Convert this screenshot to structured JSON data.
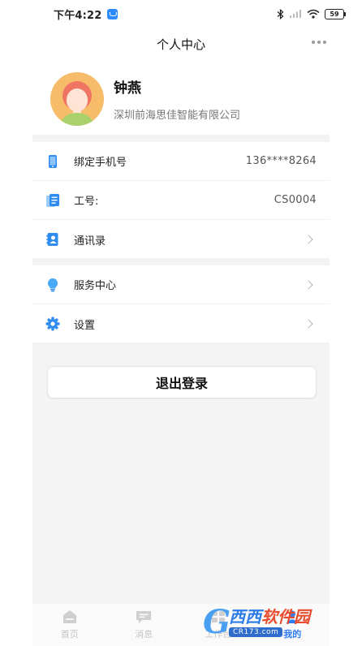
{
  "status_bar": {
    "time": "下午4:22",
    "battery": "59"
  },
  "header": {
    "title": "个人中心"
  },
  "profile": {
    "name": "钟燕",
    "company": "深圳前海思佳智能有限公司"
  },
  "info_list": [
    {
      "icon": "phone-icon",
      "label": "绑定手机号",
      "value": "136****8264"
    },
    {
      "icon": "id-card-icon",
      "label": "工号:",
      "value": "CS0004"
    },
    {
      "icon": "contacts-icon",
      "label": "通讯录",
      "value": ""
    }
  ],
  "settings_list": [
    {
      "icon": "lightbulb-icon",
      "label": "服务中心"
    },
    {
      "icon": "gear-icon",
      "label": "设置"
    }
  ],
  "logout_label": "退出登录",
  "tabbar": {
    "items": [
      {
        "label": "首页",
        "icon": "home-icon",
        "active": false
      },
      {
        "label": "消息",
        "icon": "message-icon",
        "active": false
      },
      {
        "label": "工作台",
        "icon": "workbench-icon",
        "active": false
      },
      {
        "label": "我的",
        "icon": "profile-icon",
        "active": true
      }
    ]
  },
  "watermark": {
    "title_a": "西西",
    "title_b": "软件园",
    "subtitle": "CR173.com"
  },
  "colors": {
    "accent": "#2f7df6",
    "page_gray": "#f4f4f4"
  }
}
